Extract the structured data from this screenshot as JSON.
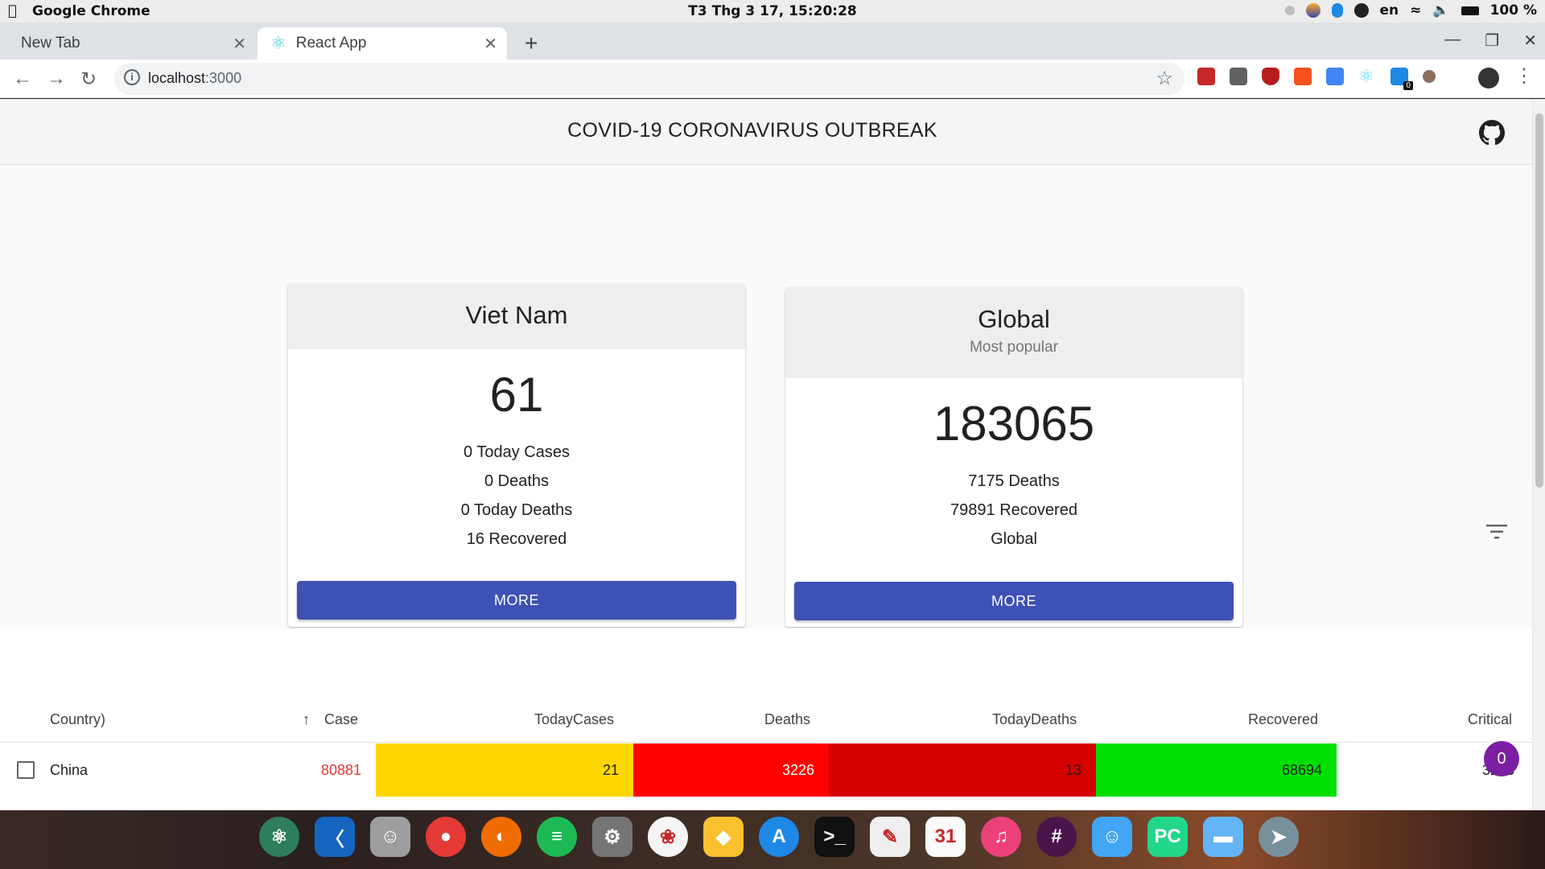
{
  "os": {
    "app_name": "Google Chrome",
    "clock": "T3 Thg 3 17, 15:20:28",
    "lang": "en",
    "battery": "100 %"
  },
  "browser": {
    "tabs": [
      {
        "label": "New Tab"
      },
      {
        "label": "React App"
      }
    ],
    "url_host": "localhost",
    "url_port": ":3000",
    "ext_badge": "0"
  },
  "page": {
    "title": "COVID-19 CORONAVIRUS OUTBREAK",
    "cards": {
      "vietnam": {
        "name": "Viet Nam",
        "cases": "61",
        "lines": [
          "0 Today Cases",
          "0 Deaths",
          "0 Today Deaths",
          "16 Recovered"
        ],
        "button": "MORE"
      },
      "global": {
        "name": "Global",
        "subtitle": "Most popular",
        "cases": "183065",
        "lines": [
          "7175 Deaths",
          "79891 Recovered",
          "Global"
        ],
        "button": "MORE"
      }
    },
    "table": {
      "headers": [
        "Country)",
        "Case",
        "TodayCases",
        "Deaths",
        "TodayDeaths",
        "Recovered",
        "Critical"
      ],
      "rows": [
        {
          "country": "China",
          "case": "80881",
          "todayCases": "21",
          "deaths": "3226",
          "todayDeaths": "13",
          "recovered": "68694",
          "critical": "3226"
        }
      ]
    },
    "fab_count": "0"
  },
  "colors": {
    "primary": "#3f51b5",
    "today_cases_bg": "#ffd600",
    "deaths_bg": "#ff0000",
    "today_deaths_bg": "#d50000",
    "recovered_bg": "#00e000",
    "case_text": "#e53935",
    "fab": "#7b1fa2"
  },
  "dock": [
    "atom-icon",
    "vscode-icon",
    "ghost-icon",
    "chrome-icon",
    "firefox-icon",
    "spotify-icon",
    "settings-icon",
    "photos-icon",
    "sketch-icon",
    "appstore-icon",
    "terminal-icon",
    "textedit-icon",
    "calendar-icon",
    "itunes-icon",
    "slack-icon",
    "finder-icon",
    "pycharm-icon",
    "folder-icon",
    "launchpad-icon"
  ]
}
